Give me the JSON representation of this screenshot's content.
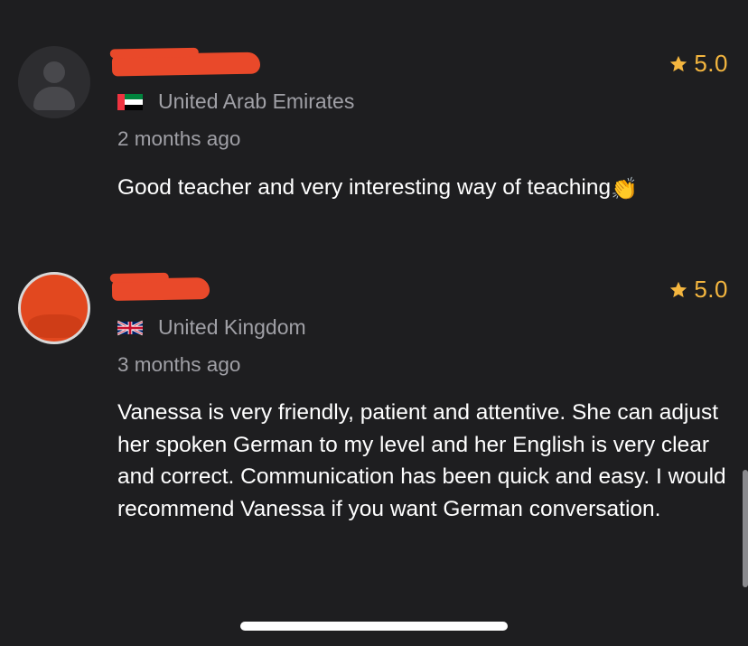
{
  "reviews": [
    {
      "rating": "5.0",
      "country": "United Arab Emirates",
      "flag_icon": "uae-flag-icon",
      "date": "2 months ago",
      "text": "Good teacher and very interesting way of teaching",
      "emoji": "👏"
    },
    {
      "rating": "5.0",
      "country": "United Kingdom",
      "flag_icon": "uk-flag-icon",
      "date": "3 months ago",
      "text": "Vanessa is very friendly, patient and attentive.  She can adjust her spoken German to my level and her English is very clear and correct.  Communication has been quick and easy. I would recommend Vanessa if you want German conversation."
    }
  ],
  "colors": {
    "background": "#1e1e20",
    "star": "#f4b63f",
    "muted_text": "#a0a0a6",
    "redaction": "#e9492a"
  }
}
